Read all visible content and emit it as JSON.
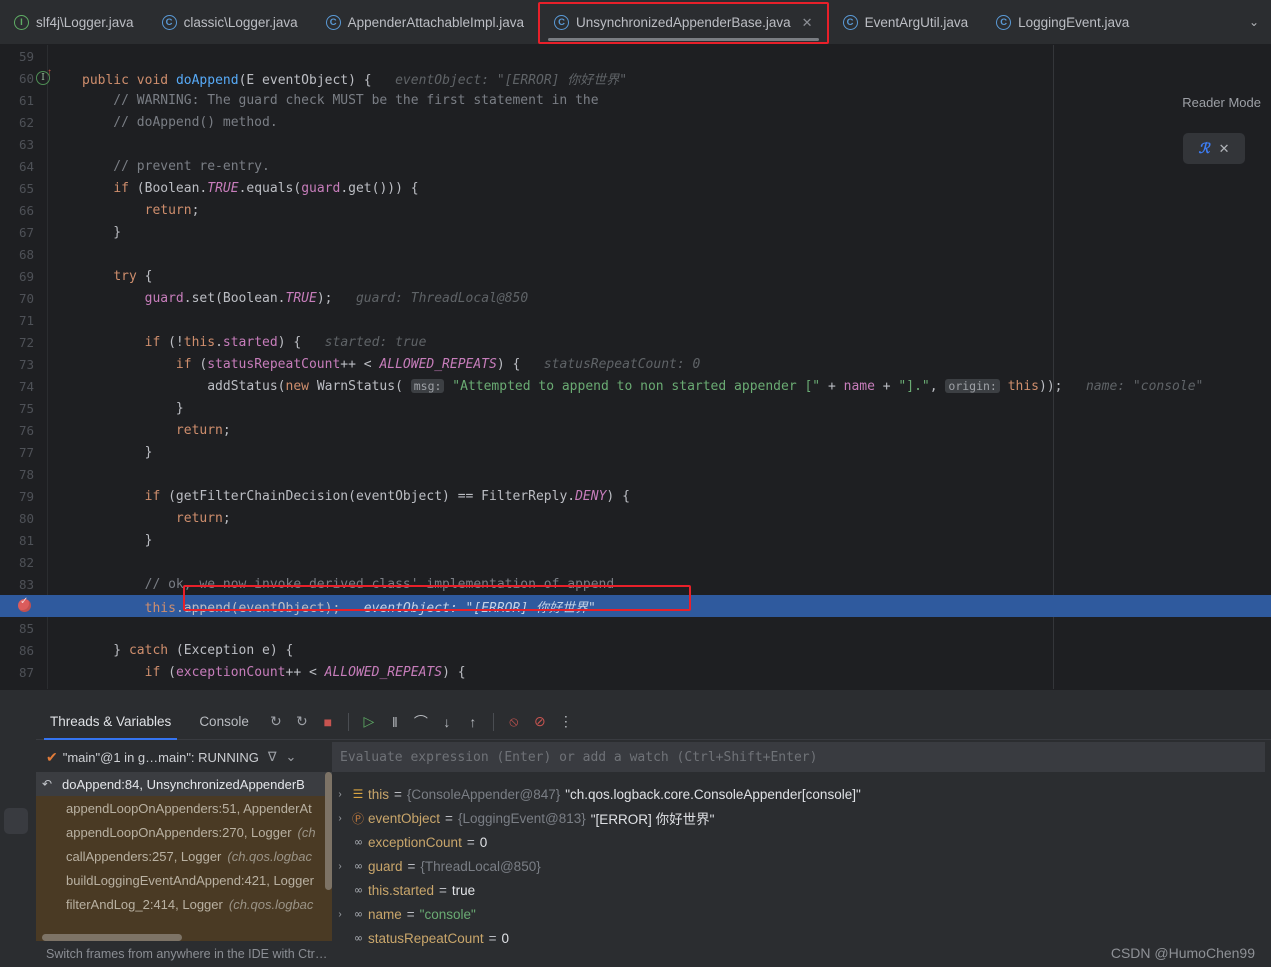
{
  "window": {
    "watermark": "CSDN @HumoChen99",
    "accent_blue": "#3574f0",
    "highlight_blue": "#2f5a9e",
    "red_box": "#e8202a"
  },
  "tabbar": {
    "tabs": [
      {
        "label": "slf4j\\Logger.java",
        "icon": "interface-icon",
        "icon_letter": "I",
        "active": false
      },
      {
        "label": "classic\\Logger.java",
        "icon": "class-icon",
        "icon_letter": "C",
        "active": false
      },
      {
        "label": "AppenderAttachableImpl.java",
        "icon": "class-icon",
        "icon_letter": "C",
        "active": false
      },
      {
        "label": "UnsynchronizedAppenderBase.java",
        "icon": "class-icon",
        "icon_letter": "C",
        "active": true,
        "close_glyph": "✕"
      },
      {
        "label": "EventArgUtil.java",
        "icon": "class-icon",
        "icon_letter": "C",
        "active": false
      },
      {
        "label": "LoggingEvent.java",
        "icon": "class-icon",
        "icon_letter": "C",
        "active": false
      }
    ],
    "overflow_glyph": "⌄"
  },
  "editor": {
    "reader_mode_label": "Reader Mode",
    "reader_widget": {
      "glyph": "ℛ",
      "close_glyph": "✕"
    },
    "lines": [
      {
        "num": "59",
        "text": ""
      },
      {
        "num": "60",
        "gutter": "run-method-icon",
        "tokens": [
          {
            "t": "public ",
            "c": "kw"
          },
          {
            "t": "void ",
            "c": "kw"
          },
          {
            "t": "doAppend",
            "c": "fn"
          },
          {
            "t": "(",
            "c": "plain"
          },
          {
            "t": "E",
            "c": "type"
          },
          {
            "t": " eventObject) {",
            "c": "plain"
          },
          {
            "t": "   eventObject: ",
            "c": "hint"
          },
          {
            "t": "\"[ERROR] 你好世界\"",
            "c": "hint"
          }
        ]
      },
      {
        "num": "61",
        "tokens": [
          {
            "t": "    // WARNING: The guard check MUST be the first statement in the",
            "c": "cmt"
          }
        ]
      },
      {
        "num": "62",
        "tokens": [
          {
            "t": "    // doAppend() method.",
            "c": "cmt"
          }
        ]
      },
      {
        "num": "63",
        "tokens": []
      },
      {
        "num": "64",
        "tokens": [
          {
            "t": "    // prevent re-entry.",
            "c": "cmt"
          }
        ]
      },
      {
        "num": "65",
        "tokens": [
          {
            "t": "    ",
            "c": "plain"
          },
          {
            "t": "if",
            "c": "kw"
          },
          {
            "t": " (Boolean.",
            "c": "plain"
          },
          {
            "t": "TRUE",
            "c": "cons"
          },
          {
            "t": ".equals(",
            "c": "plain"
          },
          {
            "t": "guard",
            "c": "fld"
          },
          {
            "t": ".get())) {",
            "c": "plain"
          }
        ]
      },
      {
        "num": "66",
        "tokens": [
          {
            "t": "        ",
            "c": "plain"
          },
          {
            "t": "return",
            "c": "kw"
          },
          {
            "t": ";",
            "c": "plain"
          }
        ]
      },
      {
        "num": "67",
        "tokens": [
          {
            "t": "    }",
            "c": "plain"
          }
        ]
      },
      {
        "num": "68",
        "tokens": []
      },
      {
        "num": "69",
        "tokens": [
          {
            "t": "    ",
            "c": "plain"
          },
          {
            "t": "try",
            "c": "kw"
          },
          {
            "t": " {",
            "c": "plain"
          }
        ]
      },
      {
        "num": "70",
        "tokens": [
          {
            "t": "        ",
            "c": "plain"
          },
          {
            "t": "guard",
            "c": "fld"
          },
          {
            "t": ".set(Boolean.",
            "c": "plain"
          },
          {
            "t": "TRUE",
            "c": "cons"
          },
          {
            "t": ");",
            "c": "plain"
          },
          {
            "t": "   guard: ThreadLocal@850",
            "c": "hint"
          }
        ]
      },
      {
        "num": "71",
        "tokens": []
      },
      {
        "num": "72",
        "tokens": [
          {
            "t": "        ",
            "c": "plain"
          },
          {
            "t": "if",
            "c": "kw"
          },
          {
            "t": " (!",
            "c": "plain"
          },
          {
            "t": "this",
            "c": "kw"
          },
          {
            "t": ".",
            "c": "plain"
          },
          {
            "t": "started",
            "c": "fld"
          },
          {
            "t": ") {",
            "c": "plain"
          },
          {
            "t": "   started: true",
            "c": "hint"
          }
        ]
      },
      {
        "num": "73",
        "tokens": [
          {
            "t": "            ",
            "c": "plain"
          },
          {
            "t": "if",
            "c": "kw"
          },
          {
            "t": " (",
            "c": "plain"
          },
          {
            "t": "statusRepeatCount",
            "c": "fld"
          },
          {
            "t": "++ < ",
            "c": "plain"
          },
          {
            "t": "ALLOWED_REPEATS",
            "c": "cons"
          },
          {
            "t": ") {",
            "c": "plain"
          },
          {
            "t": "   statusRepeatCount: 0",
            "c": "hint"
          }
        ]
      },
      {
        "num": "74",
        "tokens": [
          {
            "t": "                addStatus(",
            "c": "plain"
          },
          {
            "t": "new ",
            "c": "kw"
          },
          {
            "t": "WarnStatus",
            "c": "plain"
          },
          {
            "t": "( ",
            "c": "plain"
          },
          {
            "t": "msg:",
            "c": "chip"
          },
          {
            "t": " ",
            "c": "plain"
          },
          {
            "t": "\"Attempted to append to non started appender [\"",
            "c": "str"
          },
          {
            "t": " + ",
            "c": "plain"
          },
          {
            "t": "name",
            "c": "fld"
          },
          {
            "t": " + ",
            "c": "plain"
          },
          {
            "t": "\"].\"",
            "c": "str"
          },
          {
            "t": ", ",
            "c": "plain"
          },
          {
            "t": "origin:",
            "c": "chip"
          },
          {
            "t": " ",
            "c": "plain"
          },
          {
            "t": "this",
            "c": "kw"
          },
          {
            "t": "));",
            "c": "plain"
          },
          {
            "t": "   name: \"console\"",
            "c": "hint"
          }
        ]
      },
      {
        "num": "75",
        "tokens": [
          {
            "t": "            }",
            "c": "plain"
          }
        ]
      },
      {
        "num": "76",
        "tokens": [
          {
            "t": "            ",
            "c": "plain"
          },
          {
            "t": "return",
            "c": "kw"
          },
          {
            "t": ";",
            "c": "plain"
          }
        ]
      },
      {
        "num": "77",
        "tokens": [
          {
            "t": "        }",
            "c": "plain"
          }
        ]
      },
      {
        "num": "78",
        "tokens": []
      },
      {
        "num": "79",
        "tokens": [
          {
            "t": "        ",
            "c": "plain"
          },
          {
            "t": "if",
            "c": "kw"
          },
          {
            "t": " (getFilterChainDecision(eventObject) == FilterReply.",
            "c": "plain"
          },
          {
            "t": "DENY",
            "c": "cons"
          },
          {
            "t": ") {",
            "c": "plain"
          }
        ]
      },
      {
        "num": "80",
        "tokens": [
          {
            "t": "            ",
            "c": "plain"
          },
          {
            "t": "return",
            "c": "kw"
          },
          {
            "t": ";",
            "c": "plain"
          }
        ]
      },
      {
        "num": "81",
        "tokens": [
          {
            "t": "        }",
            "c": "plain"
          }
        ]
      },
      {
        "num": "82",
        "tokens": []
      },
      {
        "num": "83",
        "tokens": [
          {
            "t": "        // ok, we now invoke derived class' implementation of append",
            "c": "cmt"
          }
        ]
      },
      {
        "num": "84",
        "highlight": true,
        "gutter": "breakpoint-icon",
        "tokens": [
          {
            "t": "        ",
            "c": "plain"
          },
          {
            "t": "this",
            "c": "kw"
          },
          {
            "t": ".append(eventObject);",
            "c": "plain"
          },
          {
            "t": "   eventObject: ",
            "c": "hint"
          },
          {
            "t": "\"[ERROR] 你好世界\"",
            "c": "hint"
          }
        ]
      },
      {
        "num": "85",
        "tokens": []
      },
      {
        "num": "86",
        "tokens": [
          {
            "t": "    } ",
            "c": "plain"
          },
          {
            "t": "catch",
            "c": "kw"
          },
          {
            "t": " (Exception e) {",
            "c": "plain"
          }
        ]
      },
      {
        "num": "87",
        "tokens": [
          {
            "t": "        ",
            "c": "plain"
          },
          {
            "t": "if",
            "c": "kw"
          },
          {
            "t": " (",
            "c": "plain"
          },
          {
            "t": "exceptionCount",
            "c": "fld"
          },
          {
            "t": "++ < ",
            "c": "plain"
          },
          {
            "t": "ALLOWED_REPEATS",
            "c": "cons"
          },
          {
            "t": ") {",
            "c": "plain"
          }
        ]
      }
    ]
  },
  "debugger": {
    "tabs": [
      {
        "label": "Threads & Variables",
        "active": true
      },
      {
        "label": "Console",
        "active": false
      }
    ],
    "toolbar_icons": [
      {
        "name": "rerun-icon",
        "glyph": "↻"
      },
      {
        "name": "rerun-debug-icon",
        "glyph": "↻"
      },
      {
        "name": "stop-icon",
        "glyph": "■"
      },
      {
        "name": "resume-icon",
        "glyph": "▷"
      },
      {
        "name": "pause-icon",
        "glyph": "‖"
      },
      {
        "name": "step-over-icon",
        "glyph": "⌒"
      },
      {
        "name": "step-into-icon",
        "glyph": "↓"
      },
      {
        "name": "step-out-icon",
        "glyph": "↑"
      },
      {
        "name": "mute-breakpoints-icon",
        "glyph": "⦸"
      },
      {
        "name": "disable-breakpoints-icon",
        "glyph": "⊘"
      },
      {
        "name": "more-options-icon",
        "glyph": "⋮"
      }
    ],
    "thread_selector": {
      "check_glyph": "✔",
      "label": "\"main\"@1 in g…main\": RUNNING",
      "filter_glyph": "∇",
      "chevron_glyph": "⌄"
    },
    "evaluate_placeholder": "Evaluate expression (Enter) or add a watch (Ctrl+Shift+Enter)",
    "frames": [
      {
        "label": "doAppend:84, UnsynchronizedAppenderB",
        "pkg": "",
        "selected": true,
        "icon": "return-arrow-icon"
      },
      {
        "label": "appendLoopOnAppenders:51, AppenderAt",
        "pkg": "",
        "selected": false
      },
      {
        "label": "appendLoopOnAppenders:270, Logger ",
        "pkg": "(ch",
        "selected": false
      },
      {
        "label": "callAppenders:257, Logger ",
        "pkg": "(ch.qos.logbac",
        "selected": false
      },
      {
        "label": "buildLoggingEventAndAppend:421, Logger",
        "pkg": "",
        "selected": false
      },
      {
        "label": "filterAndLog_2:414, Logger ",
        "pkg": "(ch.qos.logbac",
        "selected": false
      }
    ],
    "frames_hint": {
      "text": "Switch frames from anywhere in the IDE with Ctr…",
      "close_glyph": "✕"
    },
    "variables": [
      {
        "expandable": true,
        "icon": "object-icon",
        "icon_glyph": "☰",
        "icon_kind": "obj",
        "name": "this",
        "ref": "{ConsoleAppender@847}",
        "value": "\"ch.qos.logback.core.ConsoleAppender[console]\"",
        "value_kind": "str-white"
      },
      {
        "expandable": true,
        "icon": "parameter-icon",
        "icon_glyph": "Ⓟ",
        "icon_kind": "param",
        "name": "eventObject",
        "ref": "{LoggingEvent@813}",
        "value": "\"[ERROR] 你好世界\"",
        "value_kind": "str-white"
      },
      {
        "expandable": false,
        "icon": "field-icon",
        "icon_glyph": "∞",
        "icon_kind": "field",
        "name": "exceptionCount",
        "ref": "",
        "value": "0",
        "value_kind": "num"
      },
      {
        "expandable": true,
        "icon": "field-icon",
        "icon_glyph": "∞",
        "icon_kind": "field",
        "name": "guard",
        "ref": "{ThreadLocal@850}",
        "value": "",
        "value_kind": "none"
      },
      {
        "expandable": false,
        "icon": "field-icon",
        "icon_glyph": "∞",
        "icon_kind": "field",
        "name": "this.started",
        "ref": "",
        "value": "true",
        "value_kind": "bool"
      },
      {
        "expandable": true,
        "icon": "field-icon",
        "icon_glyph": "∞",
        "icon_kind": "field",
        "name": "name",
        "ref": "",
        "value": "\"console\"",
        "value_kind": "str-green"
      },
      {
        "expandable": false,
        "icon": "field-icon",
        "icon_glyph": "∞",
        "icon_kind": "field",
        "name": "statusRepeatCount",
        "ref": "",
        "value": "0",
        "value_kind": "num"
      }
    ]
  }
}
